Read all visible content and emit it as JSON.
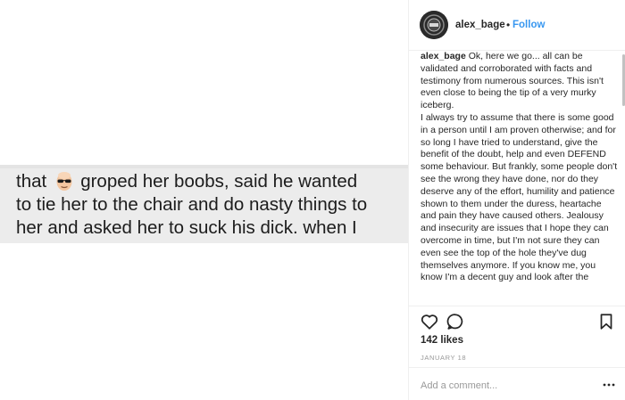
{
  "post": {
    "photo_lines": [
      "that",
      "groped her boobs, said he wanted",
      "to tie her to the chair and do nasty things to",
      "her and asked her to suck his dick. when I"
    ],
    "emoji_icon": "bald-man-sunglasses-emoji"
  },
  "header": {
    "username": "alex_bage",
    "separator": "•",
    "follow_label": "Follow",
    "avatar_icon": "profile-avatar"
  },
  "caption": {
    "username": "alex_bage",
    "paragraph_1": "Ok, here we go... all can be validated and corroborated with facts and testimony from numerous sources. This isn't even close to being the tip of a very murky iceberg.",
    "paragraph_2": "I always try to assume that there is some good in a person until I am proven otherwise; and for so long I have tried to understand, give the benefit of the doubt, help and even DEFEND some behaviour. But frankly, some people don't see the wrong they have done, nor do they deserve any of the effort, humility and patience shown to them under the duress, heartache and pain they have caused others. Jealousy and insecurity are issues that I hope they can overcome in time, but I'm not sure they can even see the top of the hole they've dug themselves anymore. If you know me, you know I'm a decent guy and look after the"
  },
  "actions": {
    "like_icon": "heart-icon",
    "comment_icon": "comment-icon",
    "save_icon": "bookmark-icon",
    "likes_text": "142 likes",
    "date_text": "JANUARY 18"
  },
  "comment": {
    "placeholder": "Add a comment...",
    "more_icon": "more-options-icon"
  },
  "colors": {
    "accent": "#3897f0",
    "text": "#262626",
    "muted": "#999999",
    "strip": "#ececec"
  }
}
